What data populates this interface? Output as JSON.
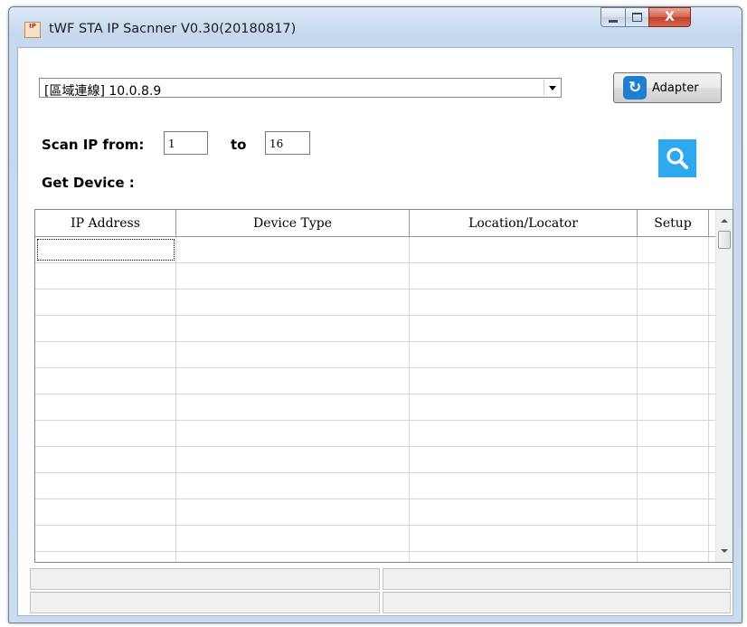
{
  "window": {
    "title": "tWF STA IP Sacnner V0.30(20180817)",
    "app_icon_text": "IP",
    "minimize_icon": "minimize-icon",
    "maximize_icon": "maximize-icon",
    "close_icon": "close-icon",
    "close_glyph": "X"
  },
  "adapter_select": {
    "selected": "[區域連線] 10.0.8.9",
    "arrow_icon": "chevron-down-icon"
  },
  "adapter_button": {
    "label": "Adapter",
    "icon": "refresh-icon",
    "icon_glyph": "↻",
    "icon_color": "#1e7fd1"
  },
  "scan": {
    "from_label": "Scan IP from:",
    "from_value": "1",
    "to_label": "to",
    "to_value": "16",
    "search_icon": "search-icon",
    "search_color": "#2fa9ee"
  },
  "get_device_label": "Get Device :",
  "device_table": {
    "columns": [
      "IP Address",
      "Device Type",
      "Location/Locator",
      "Setup"
    ],
    "rows": [
      [
        "",
        "",
        "",
        ""
      ],
      [
        "",
        "",
        "",
        ""
      ],
      [
        "",
        "",
        "",
        ""
      ],
      [
        "",
        "",
        "",
        ""
      ],
      [
        "",
        "",
        "",
        ""
      ],
      [
        "",
        "",
        "",
        ""
      ],
      [
        "",
        "",
        "",
        ""
      ],
      [
        "",
        "",
        "",
        ""
      ],
      [
        "",
        "",
        "",
        ""
      ],
      [
        "",
        "",
        "",
        ""
      ],
      [
        "",
        "",
        "",
        ""
      ],
      [
        "",
        "",
        "",
        ""
      ],
      [
        "",
        "",
        "",
        ""
      ]
    ]
  },
  "status_bar": {
    "rows": [
      [
        "",
        ""
      ],
      [
        "",
        ""
      ]
    ]
  }
}
